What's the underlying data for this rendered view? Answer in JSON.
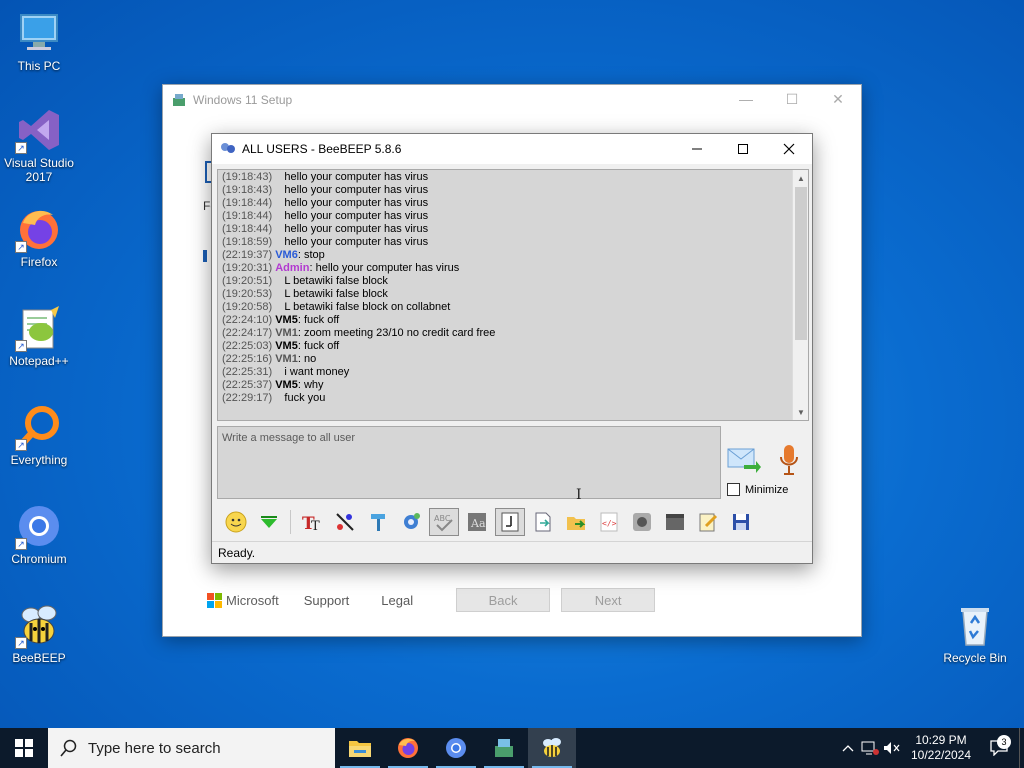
{
  "desktop": {
    "icons": [
      {
        "label": "This PC"
      },
      {
        "label": "Visual Studio 2017"
      },
      {
        "label": "Firefox"
      },
      {
        "label": "Notepad++"
      },
      {
        "label": "Everything"
      },
      {
        "label": "Chromium"
      },
      {
        "label": "BeeBEEP"
      },
      {
        "label": "Recycle Bin"
      }
    ],
    "shortcut_glyph": "↗"
  },
  "setup_window": {
    "title": "Windows 11 Setup",
    "fragment_1": "Fe",
    "footer": {
      "brand": "Microsoft",
      "support": "Support",
      "legal": "Legal",
      "back": "Back",
      "next": "Next"
    },
    "colors": {
      "ms_red": "#f25022",
      "ms_green": "#7fba00",
      "ms_blue": "#00a4ef",
      "ms_yellow": "#ffb900"
    }
  },
  "beebeep": {
    "title": "ALL USERS - BeeBEEP 5.8.6",
    "messages": [
      {
        "time": "(19:18:43)",
        "sender": "",
        "text": "hello your computer has virus"
      },
      {
        "time": "(19:18:43)",
        "sender": "",
        "text": "hello your computer has virus"
      },
      {
        "time": "(19:18:44)",
        "sender": "",
        "text": "hello your computer has virus"
      },
      {
        "time": "(19:18:44)",
        "sender": "",
        "text": "hello your computer has virus"
      },
      {
        "time": "(19:18:44)",
        "sender": "",
        "text": "hello your computer has virus"
      },
      {
        "time": "(19:18:59)",
        "sender": "",
        "text": "hello your computer has virus"
      },
      {
        "time": "(22:19:37)",
        "sender": "VM6",
        "text": "stop",
        "color": "#2a5bd7"
      },
      {
        "time": "(19:20:31)",
        "sender": "Admin",
        "text": "hello your computer has virus",
        "color": "#b23ad0"
      },
      {
        "time": "(19:20:51)",
        "sender": "",
        "text": "L betawiki false block"
      },
      {
        "time": "(19:20:53)",
        "sender": "",
        "text": "L betawiki false block"
      },
      {
        "time": "(19:20:58)",
        "sender": "",
        "text": "L betawiki false block on collabnet"
      },
      {
        "time": "(22:24:10)",
        "sender": "VM5",
        "text": "fuck off",
        "color": "#000000"
      },
      {
        "time": "(22:24:17)",
        "sender": "VM1",
        "text": "zoom meeting 23/10 no credit card free",
        "color": "#555555"
      },
      {
        "time": "(22:25:03)",
        "sender": "VM5",
        "text": "fuck off",
        "color": "#000000"
      },
      {
        "time": "(22:25:16)",
        "sender": "VM1",
        "text": "no",
        "color": "#555555"
      },
      {
        "time": "(22:25:31)",
        "sender": "",
        "text": "i want money"
      },
      {
        "time": "(22:25:37)",
        "sender": "VM5",
        "text": "why",
        "color": "#000000"
      },
      {
        "time": "(22:29:17)",
        "sender": "",
        "text": "fuck you"
      }
    ],
    "input_placeholder": "Write a message to all user",
    "minimize_label": "Minimize",
    "minimize_checked": false,
    "status": "Ready.",
    "toolbar": [
      "emoticon-icon",
      "download-icon",
      "text-font-icon",
      "text-color-icon",
      "paint-icon",
      "settings-icon",
      "spellcheck-icon",
      "font-style-icon",
      "note-icon",
      "file-icon",
      "folder-send-icon",
      "code-icon",
      "record-icon",
      "screenshot-icon",
      "edit-note-icon",
      "save-icon"
    ],
    "toolbar_active": [
      "spellcheck-icon",
      "note-icon"
    ]
  },
  "taskbar": {
    "search_placeholder": "Type here to search",
    "apps": [
      "file-explorer-icon",
      "firefox-icon",
      "chromium-icon",
      "setup-icon",
      "beebeep-icon"
    ],
    "time": "10:29 PM",
    "date": "10/22/2024",
    "notifications": "3"
  }
}
